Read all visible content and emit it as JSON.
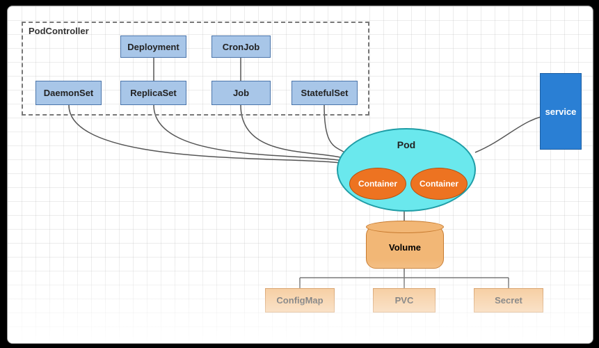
{
  "group": {
    "title": "PodController"
  },
  "controllers": {
    "deployment": "Deployment",
    "cronjob": "CronJob",
    "daemonset": "DaemonSet",
    "replicaset": "ReplicaSet",
    "job": "Job",
    "statefulset": "StatefulSet"
  },
  "pod": {
    "label": "Pod",
    "containers": [
      "Container",
      "Container"
    ]
  },
  "volume": {
    "label": "Volume"
  },
  "volumeTypes": {
    "configmap": "ConfigMap",
    "pvc": "PVC",
    "secret": "Secret"
  },
  "service": {
    "label": "service"
  }
}
